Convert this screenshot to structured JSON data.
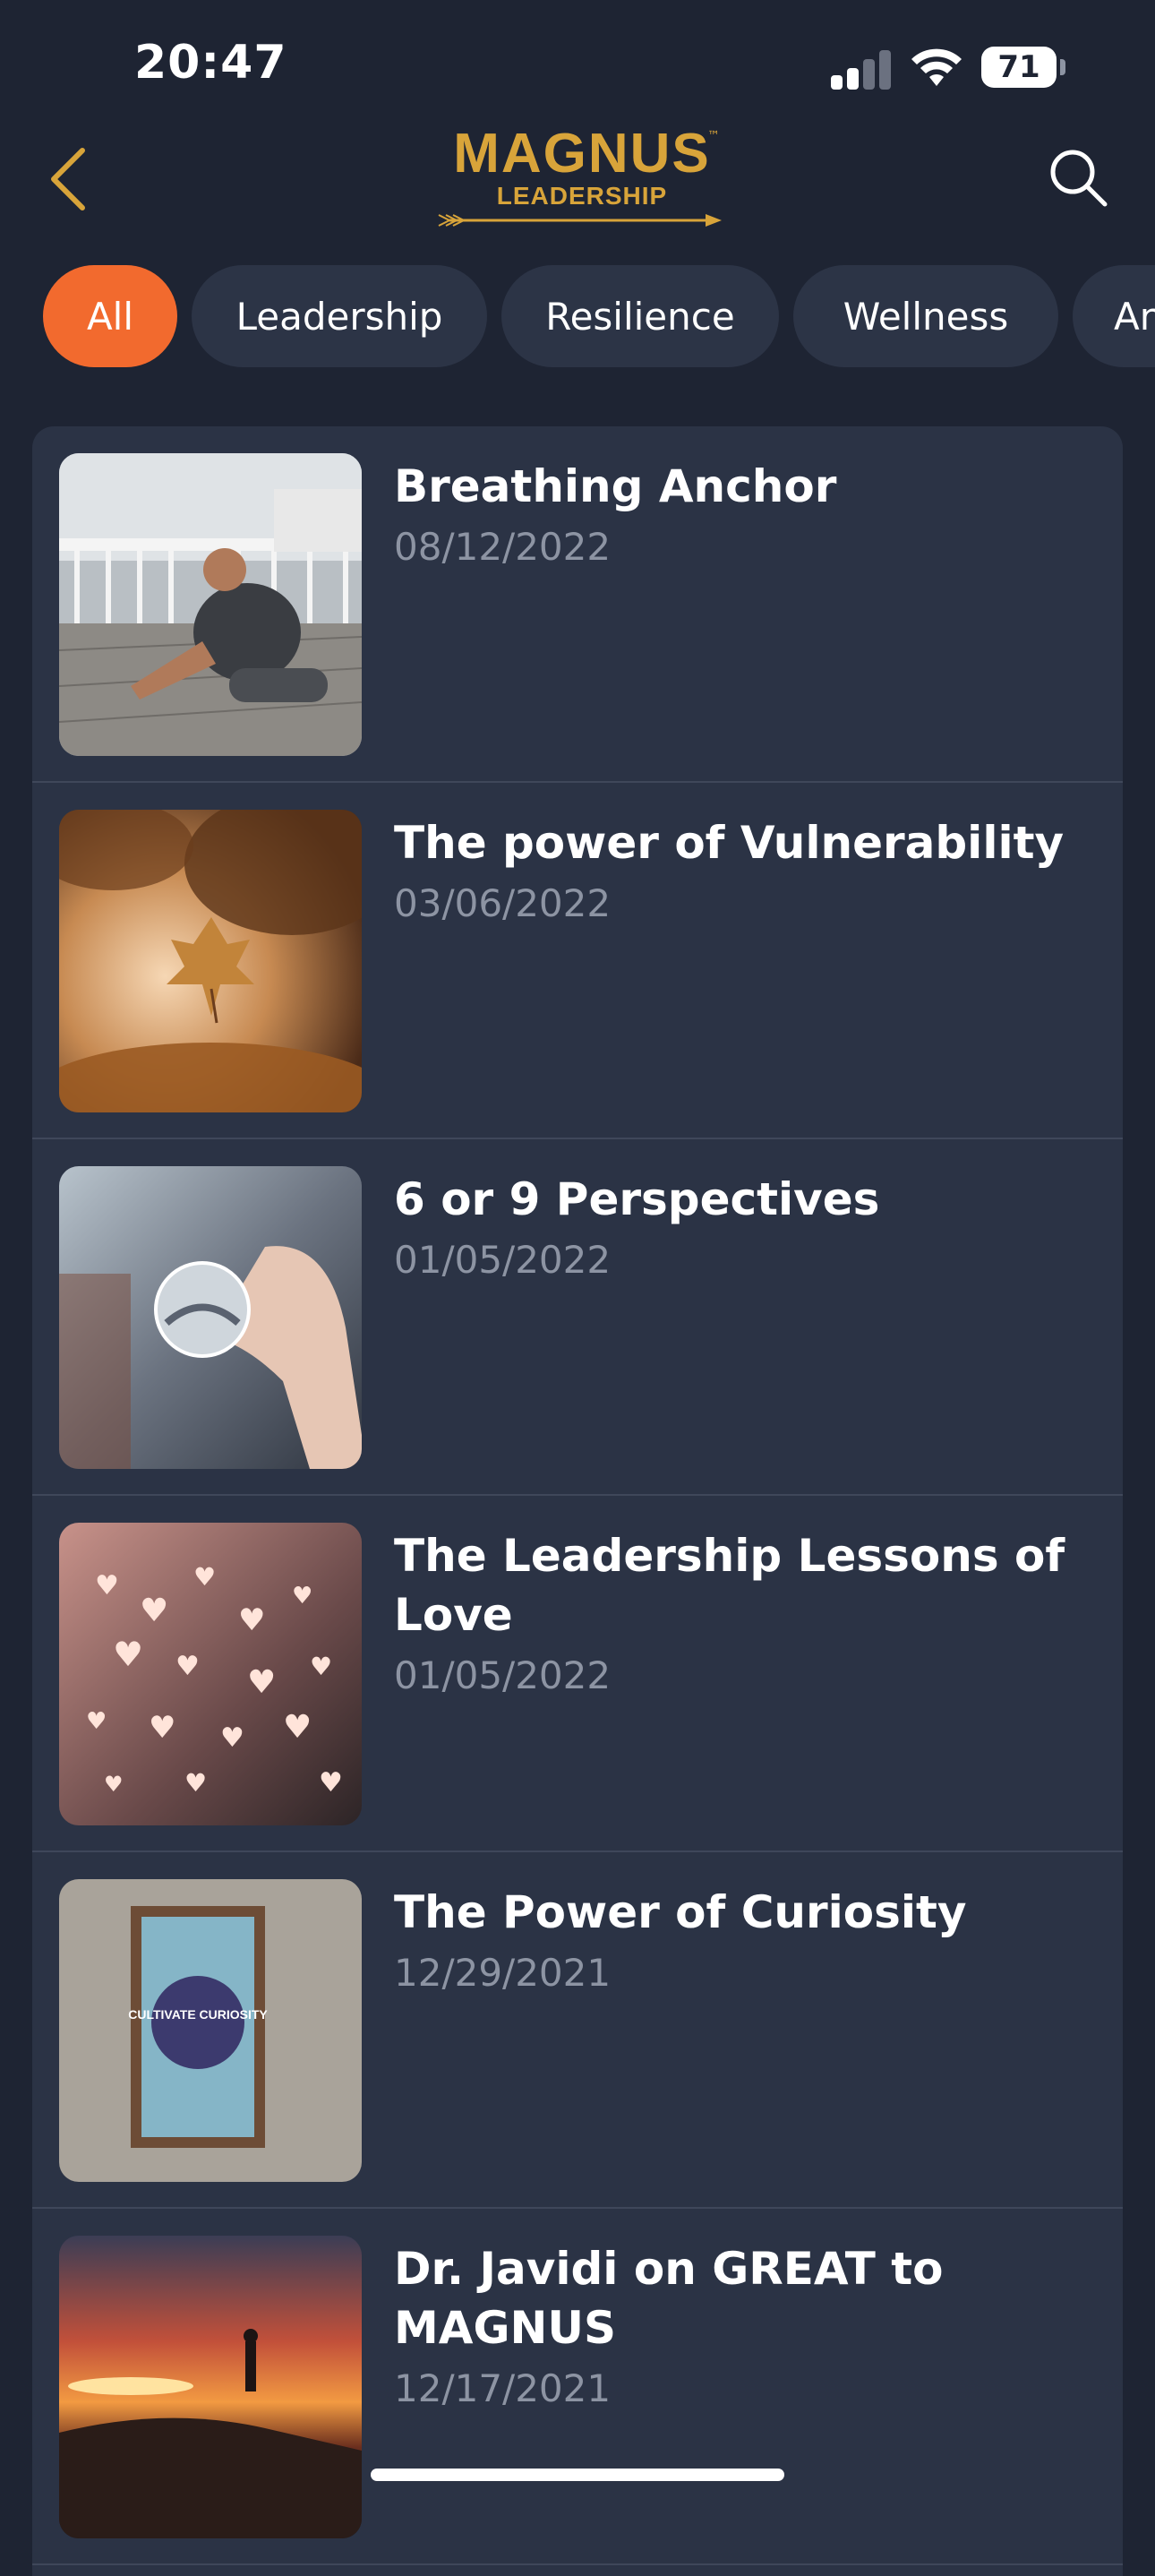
{
  "status_bar": {
    "time": "20:47",
    "battery": "71"
  },
  "header": {
    "logo_main": "MAGNUS",
    "logo_tm": "™",
    "logo_sub": "LEADERSHIP",
    "back_icon": "chevron-left-icon",
    "search_icon": "search-icon"
  },
  "filters": [
    {
      "label": "All",
      "active": true
    },
    {
      "label": "Leadership",
      "active": false
    },
    {
      "label": "Resilience",
      "active": false
    },
    {
      "label": "Wellness",
      "active": false
    },
    {
      "label": "An",
      "active": false
    }
  ],
  "items": [
    {
      "title": "Breathing Anchor",
      "date": "08/12/2022",
      "image": "man-stretching-on-deck-photo"
    },
    {
      "title": "The power of Vulnerability",
      "date": "03/06/2022",
      "image": "falling-autumn-leaf-photo"
    },
    {
      "title": "6 or 9 Perspectives",
      "date": "01/05/2022",
      "image": "hand-holding-crystal-ball-photo"
    },
    {
      "title": "The Leadership Lessons of Love",
      "date": "01/05/2022",
      "image": "heart-bokeh-lights-photo"
    },
    {
      "title": "The Power of Curiosity",
      "date": "12/29/2021",
      "image": "cultivate-curiosity-sign-photo",
      "sign_text": "CULTIVATE CURIOSITY"
    },
    {
      "title": "Dr. Javidi on GREAT to MAGNUS",
      "date": "12/17/2021",
      "image": "sunset-silhouette-photo"
    }
  ],
  "colors": {
    "accent": "#f26a2e",
    "logo_gold": "#d8a43a",
    "background": "#1e2433",
    "card": "#2b3345"
  }
}
